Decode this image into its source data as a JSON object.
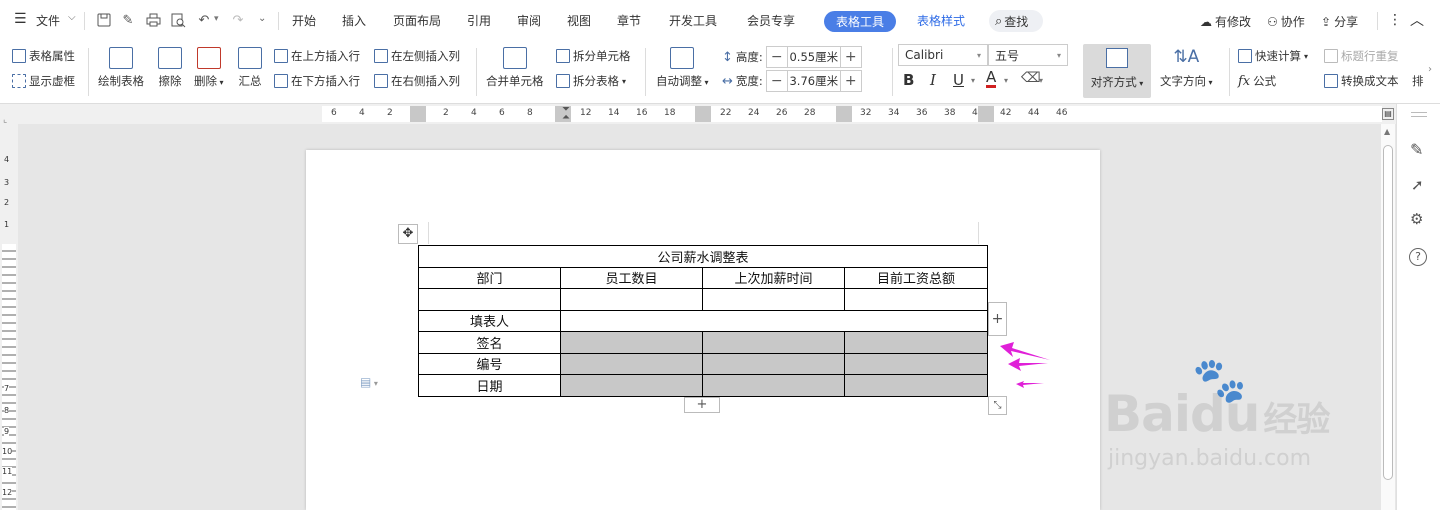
{
  "menu": {
    "file": "文件",
    "tabs": [
      "开始",
      "插入",
      "页面布局",
      "引用",
      "审阅",
      "视图",
      "章节",
      "开发工具",
      "会员专享"
    ],
    "active_tab": "表格工具",
    "style_tab": "表格样式",
    "search": "查找",
    "right": {
      "modified": "有修改",
      "collab": "协作",
      "share": "分享"
    }
  },
  "ribbon": {
    "table_props": "表格属性",
    "show_grid": "显示虚框",
    "draw_table": "绘制表格",
    "erase": "擦除",
    "delete": "删除",
    "summary": "汇总",
    "insert_row_above": "在上方插入行",
    "insert_row_below": "在下方插入行",
    "insert_col_left": "在左侧插入列",
    "insert_col_right": "在右侧插入列",
    "merge_cells": "合并单元格",
    "split_cells": "拆分单元格",
    "split_table": "拆分表格",
    "auto_adjust": "自动调整",
    "height_label": "高度:",
    "height_value": "0.55厘米",
    "width_label": "宽度:",
    "width_value": "3.76厘米",
    "font_name": "Calibri",
    "font_size": "五号",
    "align": "对齐方式",
    "text_dir": "文字方向",
    "quick_calc": "快速计算",
    "repeat_header": "标题行重复",
    "formula": "公式",
    "to_text": "转换成文本",
    "more": "排"
  },
  "ruler": {
    "h_numbers": [
      "6",
      "4",
      "2",
      "2",
      "4",
      "6",
      "8",
      "12",
      "14",
      "16",
      "18",
      "22",
      "24",
      "26",
      "28",
      "32",
      "34",
      "36",
      "38",
      "4",
      "42",
      "44",
      "46"
    ],
    "v_numbers": [
      "4",
      "3",
      "2",
      "1",
      "7",
      "8",
      "9",
      "10",
      "11",
      "12"
    ]
  },
  "table": {
    "title": "公司薪水调整表",
    "headers": [
      "部门",
      "员工数目",
      "上次加薪时间",
      "目前工资总额"
    ],
    "filler": "填表人",
    "sign": "签名",
    "number": "编号",
    "date": "日期"
  },
  "watermark": {
    "brand": "Baidu",
    "jingyan": "经验",
    "url": "jingyan.baidu.com"
  },
  "colors": {
    "accent": "#4a7ee6",
    "arrow": "#e020d8",
    "shade": "#c8c8c8"
  }
}
